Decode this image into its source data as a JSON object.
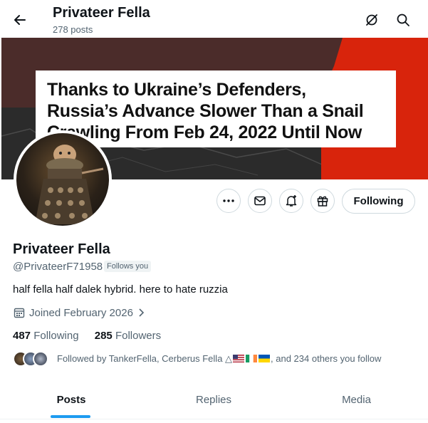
{
  "header": {
    "title": "Privateer Fella",
    "post_count": "278 posts"
  },
  "banner": {
    "headline_lines": [
      "Thanks to Ukraine’s Defenders,",
      "Russia’s Advance Slower Than a Snail",
      "Crawling From Feb 24, 2022 Until Now"
    ]
  },
  "actions": {
    "following_label": "Following"
  },
  "profile": {
    "name": "Privateer Fella",
    "handle": "@PrivateerF71958",
    "follows_you": "Follows you",
    "bio": "half fella half dalek hybrid. here to hate ruzzia",
    "joined": "Joined February 2026",
    "following_count": "487",
    "following_label": "Following",
    "followers_count": "285",
    "followers_label": "Followers",
    "followed_by_prefix": "Followed by TankerFella, Cerberus Fella △",
    "followed_by_suffix": ", and 234 others you follow"
  },
  "tabs": [
    "Posts",
    "Replies",
    "Media"
  ],
  "colors": {
    "accent": "#1d9bf0",
    "text": "#0f1419",
    "muted": "#536471",
    "banner_red": "#d8240c"
  },
  "icons": [
    "back-arrow-icon",
    "hide-icon",
    "search-icon",
    "more-icon",
    "message-icon",
    "notification-bell-icon",
    "gift-icon",
    "calendar-icon",
    "chevron-right-icon"
  ]
}
